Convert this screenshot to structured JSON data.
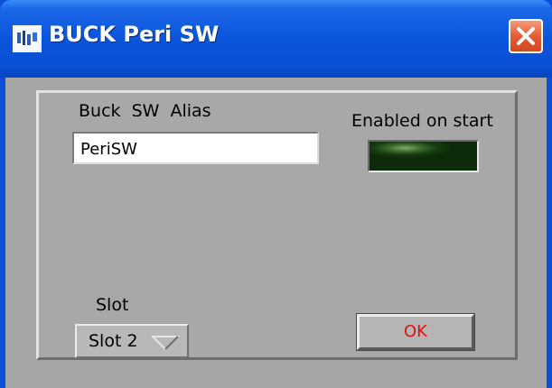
{
  "window": {
    "title": "BUCK Peri SW",
    "app_icon": "app-icon",
    "close_icon": "close-icon"
  },
  "alias": {
    "label": "Buck SW  Alias",
    "value": "PeriSW"
  },
  "enabled": {
    "label": "Enabled on start",
    "state": "off",
    "color": "#173d12"
  },
  "slot": {
    "label": "Slot",
    "selected": "Slot 2",
    "arrow_icon": "chevron-down-icon"
  },
  "ok_button": {
    "label": "OK",
    "color": "#e01010"
  }
}
